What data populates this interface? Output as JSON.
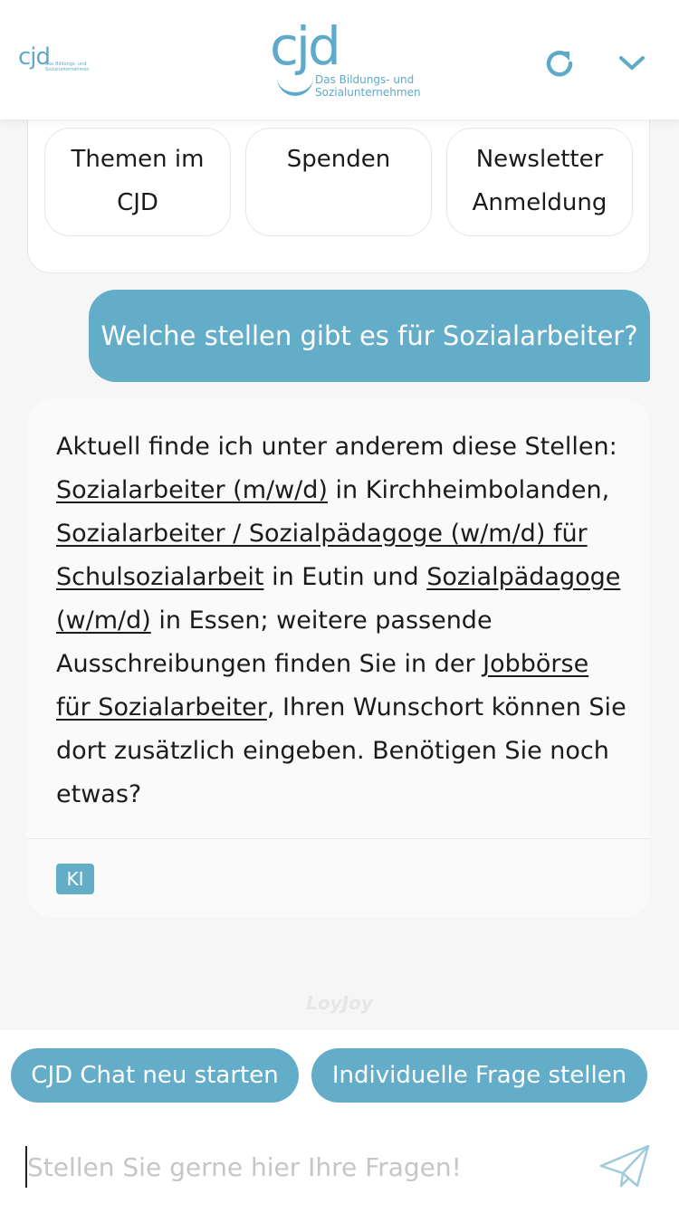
{
  "header": {
    "small_logo_mark": "cjd",
    "small_logo_tag": "Das Bildungs- und Sozialunternehmen",
    "main_logo_mark": "cjd",
    "main_logo_tag_line1": "Das Bildungs- und",
    "main_logo_tag_line2": "Sozialunternehmen",
    "refresh_icon": "refresh-icon",
    "chevron_icon": "chevron-down-icon",
    "accent_color": "#5eaac8"
  },
  "quick_replies": [
    {
      "label_line1": "Themen im",
      "label_line2": "CJD"
    },
    {
      "label_line1": "Spenden",
      "label_line2": ""
    },
    {
      "label_line1": "Newsletter",
      "label_line2": "Anmeldung"
    }
  ],
  "user_message": "Welche stellen gibt es für Sozialarbeiter?",
  "bot_message": {
    "intro": "Aktuell finde ich unter anderem diese Stellen:",
    "link1": "Sozialarbeiter (m/w/d)",
    "text1": " in Kirchheimbolanden,",
    "link2": "Sozialarbeiter / Sozialpädagoge (w/m/d) für Schulsozialarbeit",
    "text2": " in Eutin und",
    "link3": "Sozialpädagoge (w/m/d)",
    "text3": " in Essen; weitere passende Ausschreibungen finden Sie in der ",
    "link4": "Jobbörse für Sozialarbeiter",
    "text4": ", Ihren Wunschort können Sie dort zusätzlich eingeben. Benötigen Sie noch etwas?",
    "badge": "KI"
  },
  "powered_by": "LoyJoy",
  "actions": {
    "restart": "CJD Chat neu starten",
    "ask": "Individuelle Frage stellen"
  },
  "input": {
    "placeholder": "Stellen Sie gerne hier Ihre Fragen!",
    "value": "",
    "send_icon": "send-icon"
  }
}
